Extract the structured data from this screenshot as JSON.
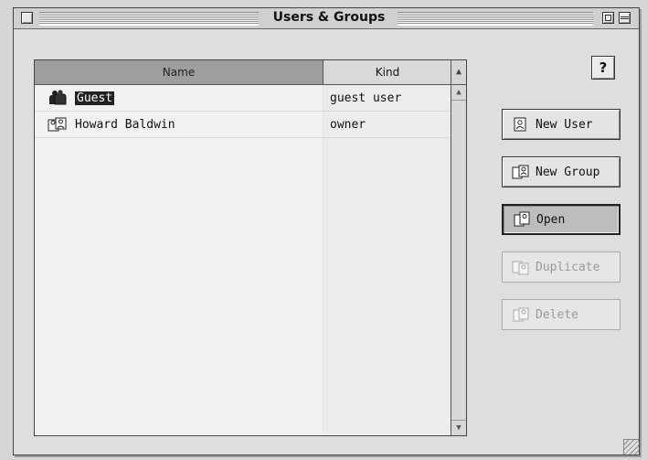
{
  "window": {
    "title": "Users & Groups"
  },
  "list": {
    "columns": {
      "name": "Name",
      "kind": "Kind"
    },
    "rows": [
      {
        "name": "Guest",
        "kind": "guest user",
        "selected": true,
        "icon": "guest-user-icon"
      },
      {
        "name": "Howard Baldwin",
        "kind": "owner",
        "selected": false,
        "icon": "owner-user-icon"
      }
    ]
  },
  "help": {
    "label": "?"
  },
  "buttons": {
    "new_user": "New User",
    "new_group": "New Group",
    "open": "Open",
    "duplicate": "Duplicate",
    "delete": "Delete"
  }
}
